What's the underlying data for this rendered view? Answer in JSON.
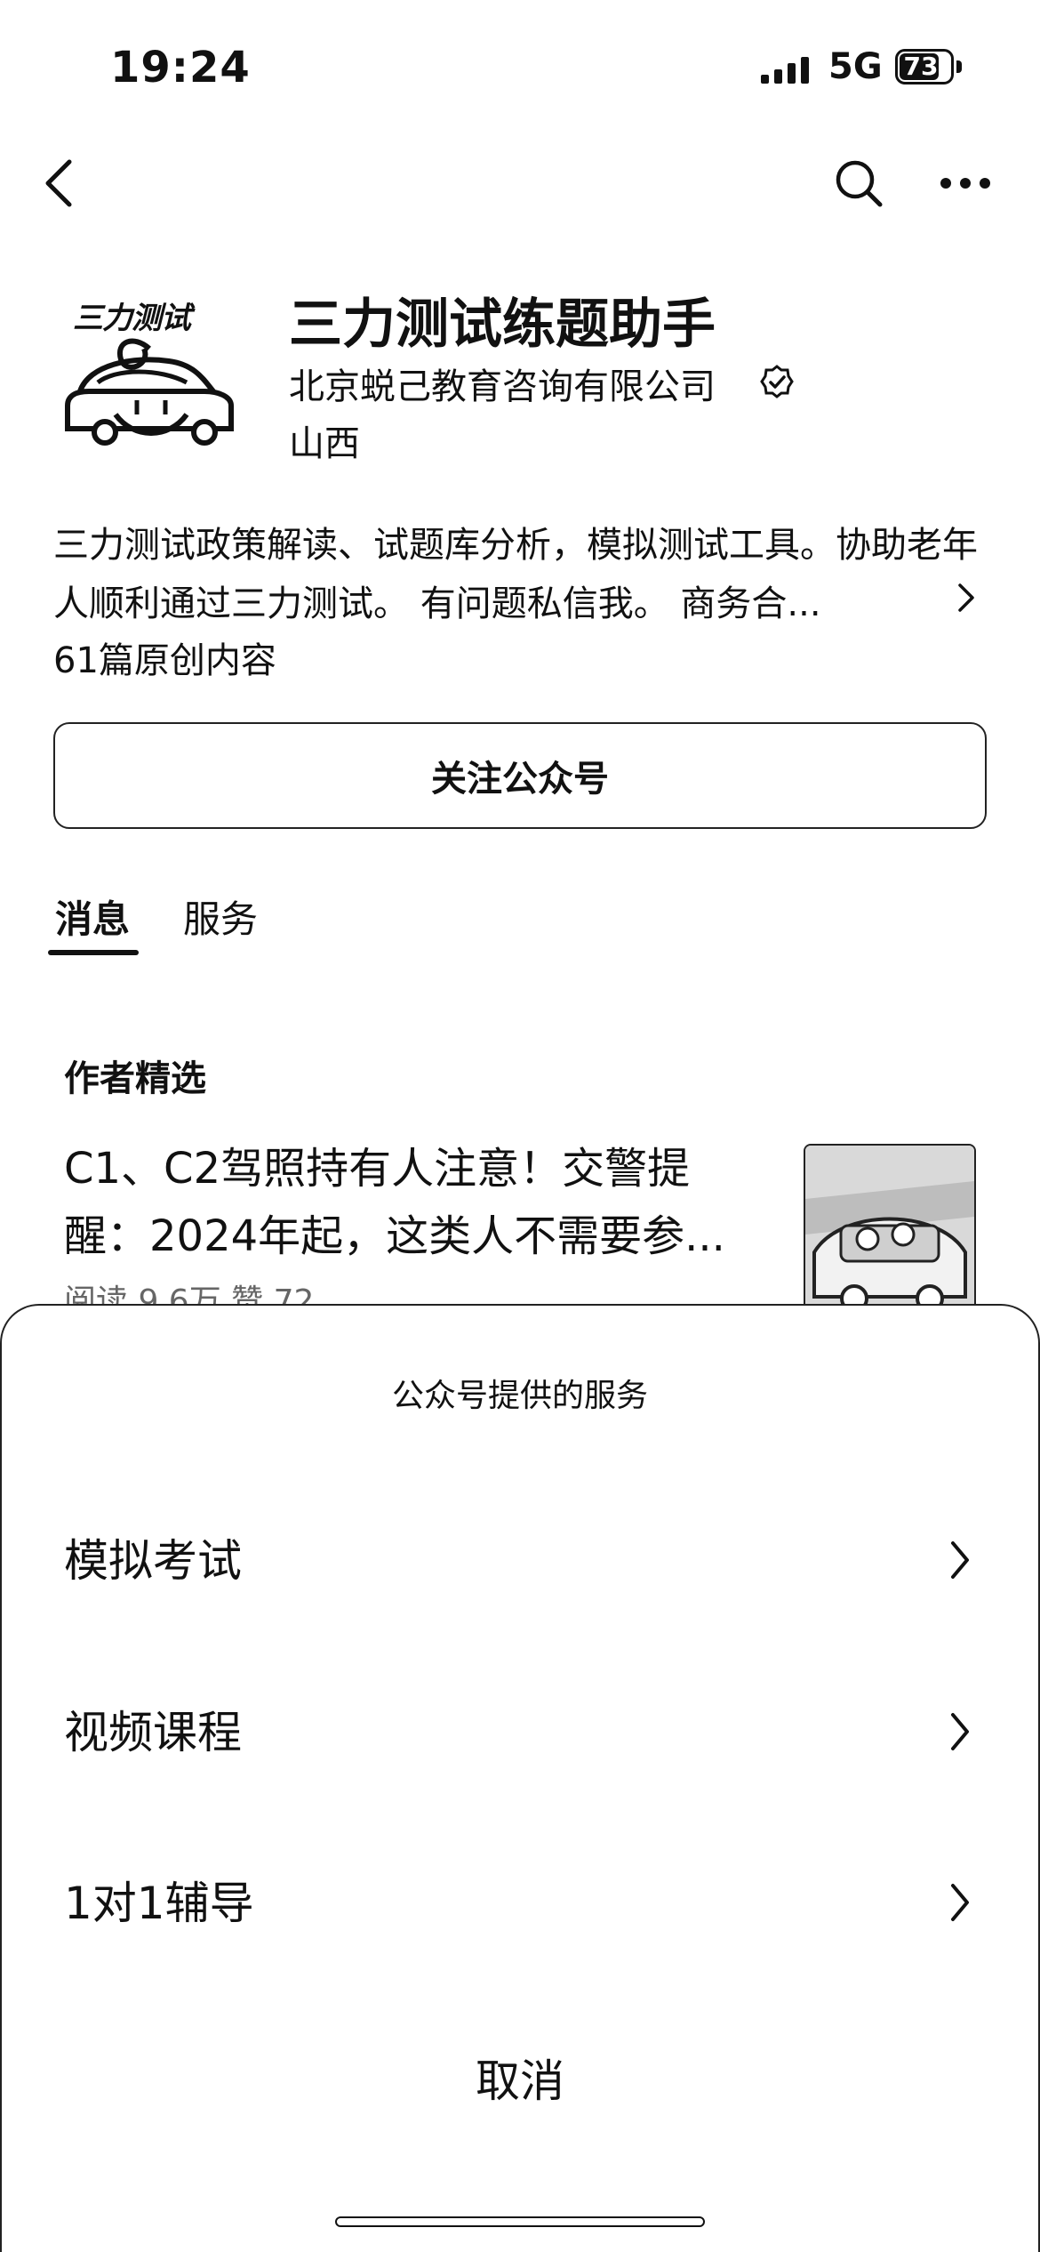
{
  "status_bar": {
    "time": "19:24",
    "network": "5G",
    "battery": "73"
  },
  "nav": {
    "back_icon": "chevron-left-icon",
    "search_icon": "search-icon",
    "more_icon": "more-icon"
  },
  "profile": {
    "logo_text": "三力测试",
    "name": "三力测试练题助手",
    "company": "北京蜕己教育咨询有限公司",
    "region": "山西",
    "description": "三力测试政策解读、试题库分析，模拟测试工具。协助老年人顺利通过三力测试。 有问题私信我。 商务合...",
    "original_count": "61篇原创内容",
    "follow_label": "关注公众号"
  },
  "tabs": [
    {
      "label": "消息"
    },
    {
      "label": "服务"
    }
  ],
  "featured": {
    "section_title": "作者精选",
    "article": {
      "title": "C1、C2驾照持有人注意！交警提醒：2024年起，这类人不需要参...",
      "stats": "阅读 9.6万  赞 72"
    }
  },
  "sheet": {
    "title": "公众号提供的服务",
    "items": [
      {
        "label": "模拟考试"
      },
      {
        "label": "视频课程"
      },
      {
        "label": "1对1辅导"
      }
    ],
    "cancel_label": "取消"
  }
}
